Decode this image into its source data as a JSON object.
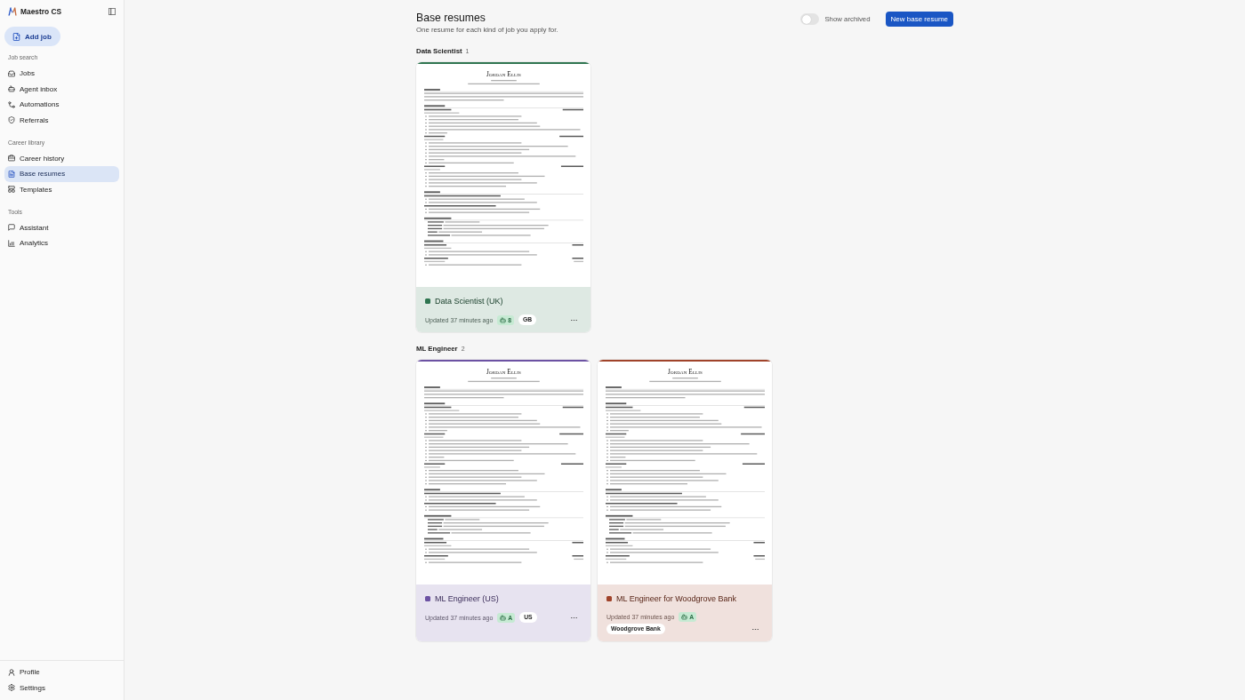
{
  "sidebar": {
    "app_name": "Maestro CS",
    "add_job_button": "Add job",
    "sections": [
      {
        "title": "Job search",
        "items": [
          {
            "label": "Jobs",
            "selected": false
          },
          {
            "label": "Agent inbox",
            "selected": false
          },
          {
            "label": "Automations",
            "selected": false
          },
          {
            "label": "Referrals",
            "selected": false
          }
        ]
      },
      {
        "title": "Career library",
        "items": [
          {
            "label": "Career history",
            "selected": false
          },
          {
            "label": "Base resumes",
            "selected": true
          },
          {
            "label": "Templates",
            "selected": false
          }
        ]
      },
      {
        "title": "Tools",
        "items": [
          {
            "label": "Assistant",
            "selected": false
          },
          {
            "label": "Analytics",
            "selected": false
          }
        ]
      }
    ],
    "footer_items": [
      {
        "label": "Profile",
        "selected": false
      },
      {
        "label": "Settings",
        "selected": false
      }
    ]
  },
  "page": {
    "title": "Base resumes",
    "subtitle": "One resume for each kind of job you apply for.",
    "show_archived": {
      "label": "Show archived",
      "on": false
    },
    "new_button": "New base resume"
  },
  "groups": [
    {
      "title": "Data Scientist",
      "count": "1",
      "resumes": [
        {
          "title": "Data Scientist (UK)",
          "color": "#2f7550",
          "updated": "Updated 37 minutes ago",
          "score": "8",
          "tags": [
            "GB"
          ],
          "document": {
            "name": "Jordan Ellis"
          }
        }
      ]
    },
    {
      "title": "ML Engineer",
      "count": "2",
      "resumes": [
        {
          "title": "ML Engineer (US)",
          "color": "#6c52a3",
          "updated": "Updated 37 minutes ago",
          "score": "A",
          "tags": [
            "US"
          ],
          "document": {
            "name": "Jordan Ellis"
          }
        },
        {
          "title": "ML Engineer for Woodgrove Bank",
          "color": "#a0432a",
          "updated": "Updated 37 minutes ago",
          "score": "A",
          "tags": [
            "Woodgrove Bank"
          ],
          "document": {
            "name": "Jordan Ellis"
          }
        }
      ]
    }
  ]
}
